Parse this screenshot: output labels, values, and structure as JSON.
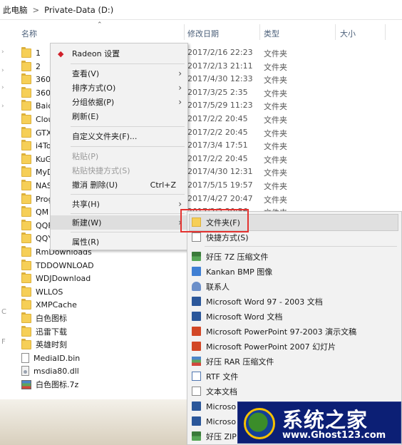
{
  "breadcrumb": {
    "root": "此电脑",
    "separator": ">",
    "location": "Private-Data (D:)"
  },
  "columns": {
    "name": "名称",
    "modified": "修改日期",
    "type": "类型",
    "size": "大小"
  },
  "files": [
    {
      "name": "1",
      "kind": "folder",
      "date": "2017/2/16 22:23",
      "type": "文件夹"
    },
    {
      "name": "2",
      "kind": "folder",
      "date": "2017/2/13 21:11",
      "type": "文件夹"
    },
    {
      "name": "360",
      "kind": "folder",
      "date": "2017/4/30 12:33",
      "type": "文件夹"
    },
    {
      "name": "360",
      "kind": "folder",
      "date": "2017/3/25 2:35",
      "type": "文件夹"
    },
    {
      "name": "Baic",
      "kind": "folder",
      "date": "2017/5/29 11:23",
      "type": "文件夹"
    },
    {
      "name": "Clou",
      "kind": "folder",
      "date": "2017/2/2 20:45",
      "type": "文件夹"
    },
    {
      "name": "GTX",
      "kind": "folder",
      "date": "2017/2/2 20:45",
      "type": "文件夹"
    },
    {
      "name": "i4To",
      "kind": "folder",
      "date": "2017/3/4 17:51",
      "type": "文件夹"
    },
    {
      "name": "KuG",
      "kind": "folder",
      "date": "2017/2/2 20:45",
      "type": "文件夹"
    },
    {
      "name": "MyD",
      "kind": "folder",
      "date": "2017/4/30 12:31",
      "type": "文件夹"
    },
    {
      "name": "NAS",
      "kind": "folder",
      "date": "2017/5/15 19:57",
      "type": "文件夹"
    },
    {
      "name": "Prog",
      "kind": "folder",
      "date": "2017/4/27 20:47",
      "type": "文件夹"
    },
    {
      "name": "QM",
      "kind": "folder",
      "date": "2017/2/2 20:56",
      "type": "文件夹"
    },
    {
      "name": "QQF",
      "kind": "folder",
      "date": "",
      "type": ""
    },
    {
      "name": "QQY",
      "kind": "folder",
      "date": "",
      "type": ""
    },
    {
      "name": "RmDownloads",
      "kind": "folder",
      "date": "",
      "type": ""
    },
    {
      "name": "TDDOWNLOAD",
      "kind": "folder",
      "date": "",
      "type": ""
    },
    {
      "name": "WDJDownload",
      "kind": "folder",
      "date": "",
      "type": ""
    },
    {
      "name": "WLLOS",
      "kind": "folder",
      "date": "",
      "type": ""
    },
    {
      "name": "XMPCache",
      "kind": "folder",
      "date": "",
      "type": ""
    },
    {
      "name": "白色图标",
      "kind": "folder",
      "date": "",
      "type": ""
    },
    {
      "name": "迅雷下载",
      "kind": "folder",
      "date": "",
      "type": ""
    },
    {
      "name": "英雄时刻",
      "kind": "folder",
      "date": "",
      "type": ""
    },
    {
      "name": "MediaID.bin",
      "kind": "file",
      "date": "",
      "type": ""
    },
    {
      "name": "msdia80.dll",
      "kind": "dll",
      "date": "",
      "type": ""
    },
    {
      "name": "白色图标.7z",
      "kind": "archive",
      "date": "",
      "type": ""
    }
  ],
  "left_pane_glyphs": [
    "C",
    "F"
  ],
  "context_menu": {
    "radeon": "Radeon 设置",
    "items": [
      {
        "label": "查看(V)",
        "arrow": true
      },
      {
        "label": "排序方式(O)",
        "arrow": true
      },
      {
        "label": "分组依据(P)",
        "arrow": true
      },
      {
        "label": "刷新(E)"
      },
      {
        "label": "自定义文件夹(F)..."
      },
      {
        "label": "粘贴(P)",
        "disabled": true
      },
      {
        "label": "粘贴快捷方式(S)",
        "disabled": true
      },
      {
        "label": "撤消 删除(U)",
        "shortcut": "Ctrl+Z"
      },
      {
        "label": "共享(H)",
        "arrow": true
      },
      {
        "label": "新建(W)",
        "arrow": true
      },
      {
        "label": "属性(R)"
      }
    ],
    "arrow_glyph": "›"
  },
  "new_submenu": {
    "items": [
      {
        "label": "文件夹(F)",
        "icon": "folder-icon"
      },
      {
        "label": "快捷方式(S)",
        "icon": "shortcut-icon"
      },
      {
        "label": "好压 7Z 压缩文件",
        "icon": "haozip-7z-icon"
      },
      {
        "label": "Kankan BMP 图像",
        "icon": "bmp-image-icon"
      },
      {
        "label": "联系人",
        "icon": "contact-icon"
      },
      {
        "label": "Microsoft Word 97 - 2003 文档",
        "icon": "word-icon"
      },
      {
        "label": "Microsoft Word 文档",
        "icon": "word-icon"
      },
      {
        "label": "Microsoft PowerPoint 97-2003 演示文稿",
        "icon": "powerpoint-icon"
      },
      {
        "label": "Microsoft PowerPoint 2007 幻灯片",
        "icon": "powerpoint-icon"
      },
      {
        "label": "好压 RAR 压缩文件",
        "icon": "haozip-rar-icon"
      },
      {
        "label": "RTF 文件",
        "icon": "rtf-icon"
      },
      {
        "label": "文本文档",
        "icon": "text-document-icon"
      },
      {
        "label": "Microso",
        "icon": "word-icon"
      },
      {
        "label": "Microso",
        "icon": "word-icon"
      },
      {
        "label": "好压 ZIP",
        "icon": "haozip-zip-icon"
      }
    ]
  },
  "watermark": {
    "title": "系统之家",
    "url": "www.Ghost123.com"
  },
  "colors": {
    "highlight_box": "#e4322f",
    "menu_bg": "#f2f2f2",
    "folder": "#f6cf57",
    "watermark_bg": "#0c1f75"
  }
}
